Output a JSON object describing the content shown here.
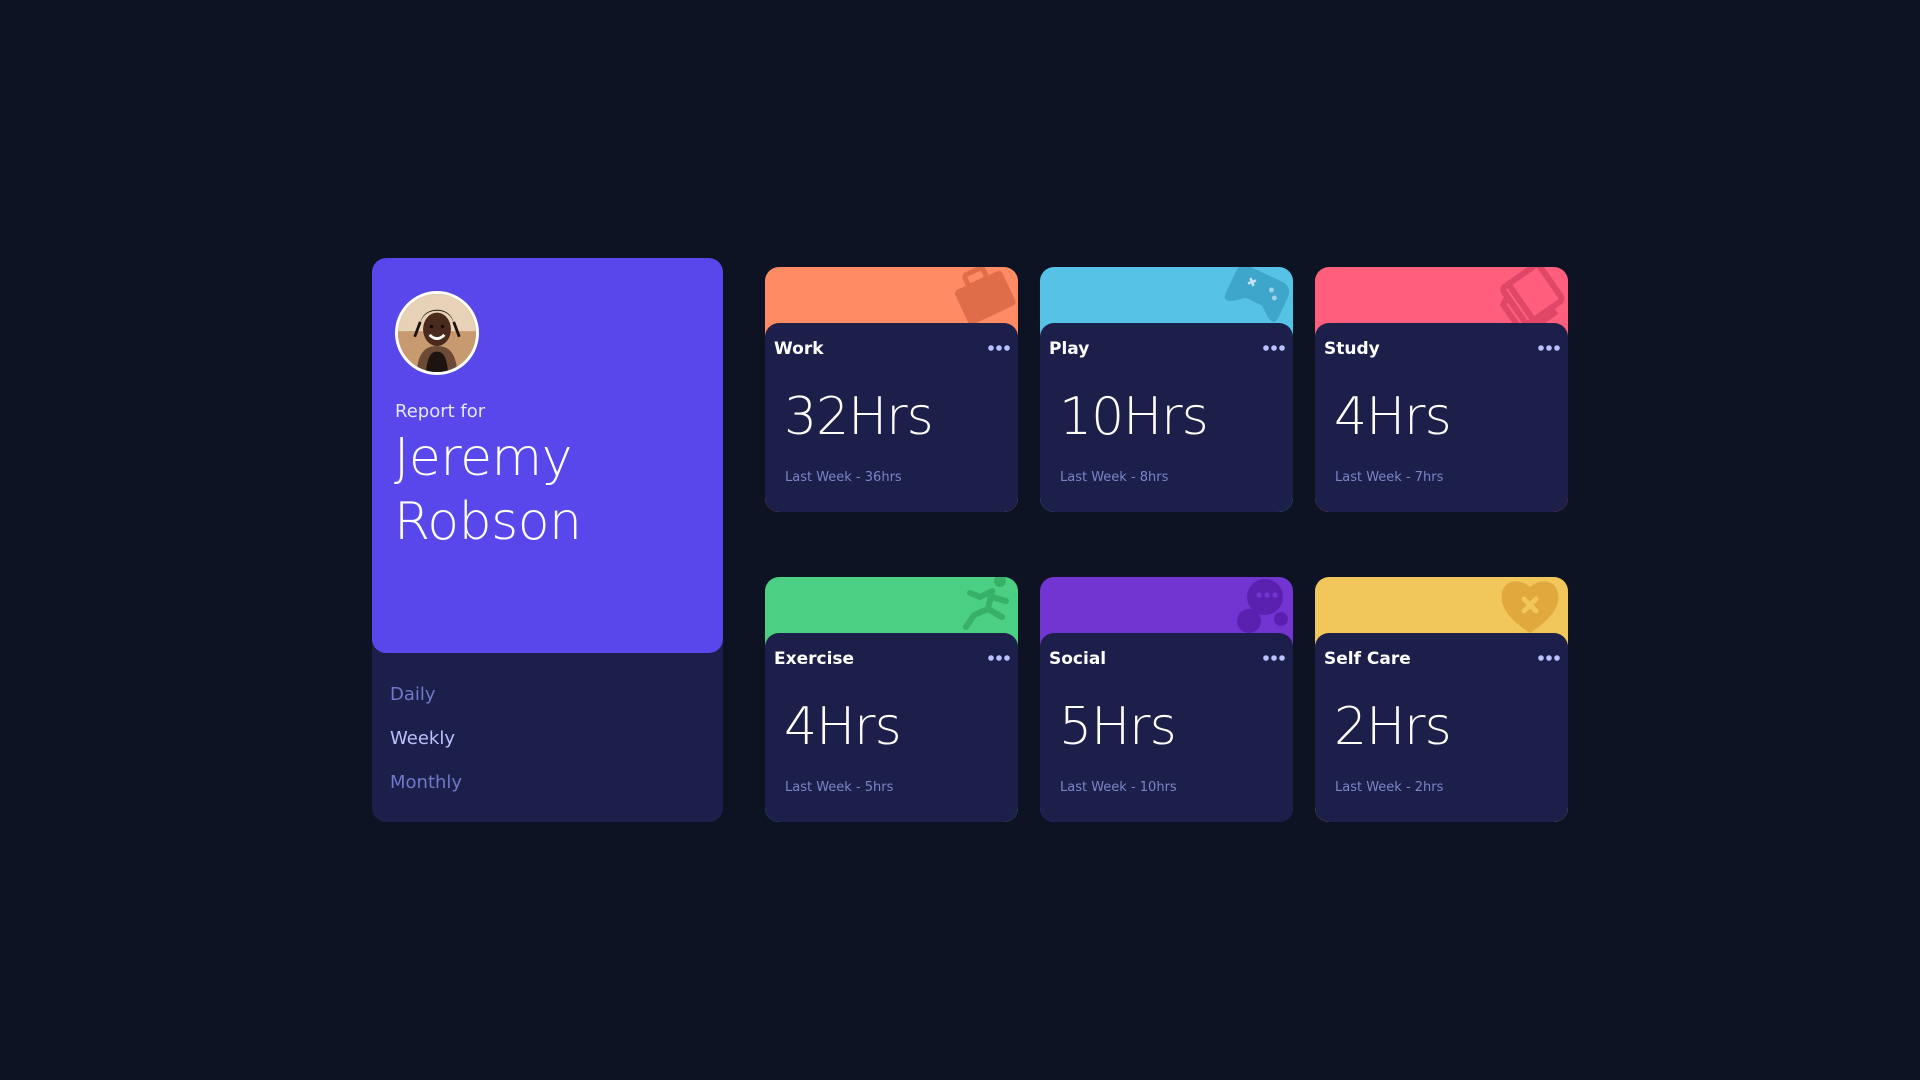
{
  "profile": {
    "report_label": "Report for",
    "first_name": "Jeremy",
    "last_name": "Robson"
  },
  "timeframes": [
    {
      "label": "Daily",
      "active": false
    },
    {
      "label": "Weekly",
      "active": true
    },
    {
      "label": "Monthly",
      "active": false
    }
  ],
  "activities": [
    {
      "title": "Work",
      "hours": "32Hrs",
      "previous": "Last Week - 36hrs",
      "color": "#ff8b64",
      "icon": "briefcase-icon"
    },
    {
      "title": "Play",
      "hours": "10Hrs",
      "previous": "Last Week - 8hrs",
      "color": "#55c2e6",
      "icon": "gamepad-icon"
    },
    {
      "title": "Study",
      "hours": "4Hrs",
      "previous": "Last Week - 7hrs",
      "color": "#ff5e7d",
      "icon": "book-icon"
    },
    {
      "title": "Exercise",
      "hours": "4Hrs",
      "previous": "Last Week - 5hrs",
      "color": "#4bcf82",
      "icon": "runner-icon"
    },
    {
      "title": "Social",
      "hours": "5Hrs",
      "previous": "Last Week - 10hrs",
      "color": "#7335d2",
      "icon": "chat-icon"
    },
    {
      "title": "Self Care",
      "hours": "2Hrs",
      "previous": "Last Week - 2hrs",
      "color": "#f1c75b",
      "icon": "heart-icon"
    }
  ],
  "colors": {
    "background": "#0e1323",
    "card": "#1c1f4a",
    "accent": "#5847eb",
    "muted": "#7078c9",
    "pale": "#bdc1ff"
  }
}
